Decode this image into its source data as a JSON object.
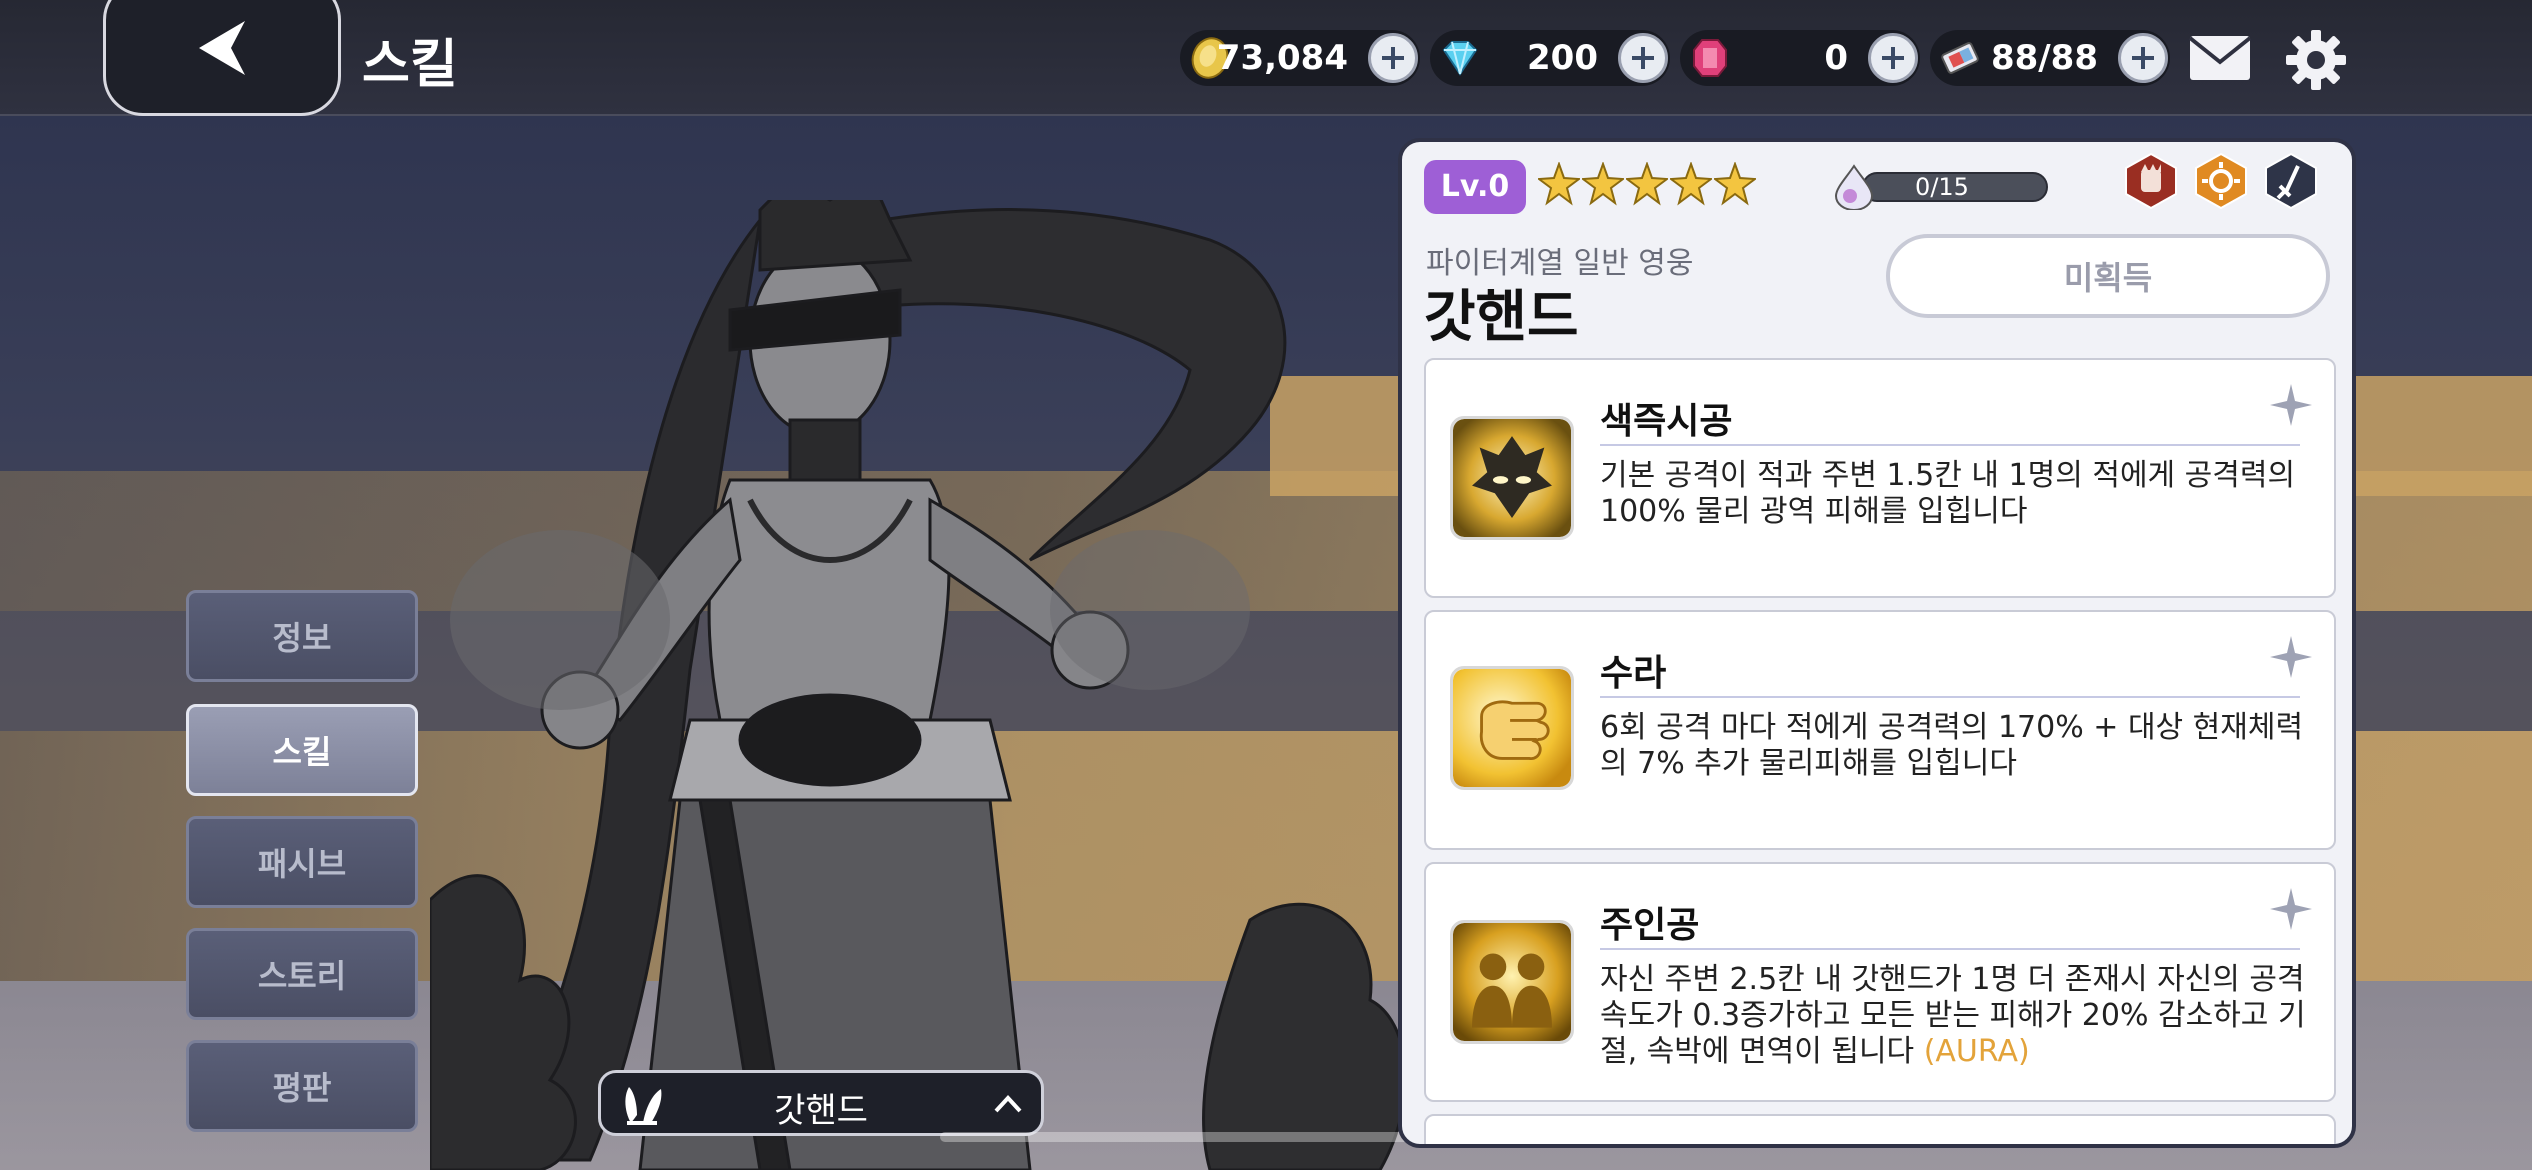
{
  "header": {
    "title": "스킬",
    "currencies": [
      {
        "name": "gold",
        "value": "73,084",
        "color": "#e8c64a"
      },
      {
        "name": "diamond",
        "value": "200",
        "color": "#5ad0f0"
      },
      {
        "name": "ruby",
        "value": "0",
        "color": "#e0407a"
      },
      {
        "name": "ticket",
        "value": "88/88",
        "color": "#7ab0e0"
      }
    ]
  },
  "side_tabs": [
    "정보",
    "스킬",
    "패시브",
    "스토리",
    "평판"
  ],
  "active_tab": "스킬",
  "hero_selector": {
    "name": "갓핸드"
  },
  "panel": {
    "level": "Lv.0",
    "stars": 5,
    "exp": "0/15",
    "subtitle": "파이터계열 일반 영웅",
    "hero_name": "갓핸드",
    "status_button": "미획득",
    "skills": [
      {
        "title": "색즉시공",
        "desc": "기본 공격이 적과 주변 1.5칸 내 1명의 적에게 공격력의 100% 물리 광역 피해를 입힙니다"
      },
      {
        "title": "수라",
        "desc": "6회 공격 마다 적에게 공격력의 170% + 대상 현재체력의 7% 추가 물리피해를 입힙니다"
      },
      {
        "title": "주인공",
        "desc": "자신 주변 2.5칸 내 갓핸드가 1명 더 존재시 자신의 공격속도가 0.3증가하고 모든 받는 피해가 20% 감소하고 기절, 속박에 면역이 됩니다",
        "tag": "(AURA)"
      }
    ]
  }
}
